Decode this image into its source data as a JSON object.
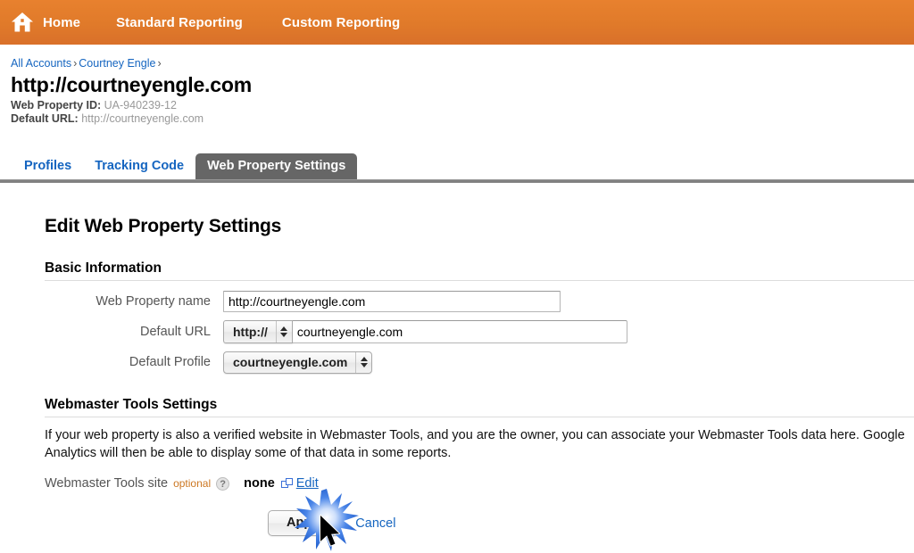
{
  "navbar": {
    "home_icon": "home-icon",
    "items": [
      {
        "label": "Home"
      },
      {
        "label": "Standard Reporting"
      },
      {
        "label": "Custom Reporting"
      }
    ]
  },
  "breadcrumb": {
    "items": [
      {
        "label": "All Accounts"
      },
      {
        "label": "Courtney Engle"
      }
    ],
    "separator": "›"
  },
  "header": {
    "title": "http://courtneyengle.com",
    "web_property_id_label": "Web Property ID:",
    "web_property_id_value": "UA-940239-12",
    "default_url_label": "Default URL:",
    "default_url_value": "http://courtneyengle.com"
  },
  "tabs": [
    {
      "label": "Profiles",
      "active": false
    },
    {
      "label": "Tracking Code",
      "active": false
    },
    {
      "label": "Web Property Settings",
      "active": true
    }
  ],
  "form": {
    "title": "Edit Web Property Settings",
    "basic_section_heading": "Basic Information",
    "fields": {
      "web_property_name": {
        "label": "Web Property name",
        "value": "http://courtneyengle.com"
      },
      "default_url": {
        "label": "Default URL",
        "protocol_selected": "http://",
        "value": "courtneyengle.com"
      },
      "default_profile": {
        "label": "Default Profile",
        "selected": "courtneyengle.com"
      }
    }
  },
  "webmaster": {
    "section_heading": "Webmaster Tools Settings",
    "paragraph": "If your web property is also a verified website in Webmaster Tools, and you are the owner, you can associate your Webmaster Tools data here. Google Analytics will then be able to display some of that data in some reports.",
    "site_label": "Webmaster Tools site",
    "optional_label": "optional",
    "help_icon_glyph": "?",
    "site_value": "none",
    "edit_link_label": "Edit",
    "external_link_icon": "external-link-icon"
  },
  "actions": {
    "apply_label": "Apply",
    "cancel_label": "Cancel"
  },
  "colors": {
    "nav_orange_top": "#e8812e",
    "nav_orange_bottom": "#d9702a",
    "link_blue": "#1565c0",
    "active_tab_gray": "#666666",
    "optional_orange": "#cc7722",
    "click_burst_blue": "#1f6fe0"
  }
}
